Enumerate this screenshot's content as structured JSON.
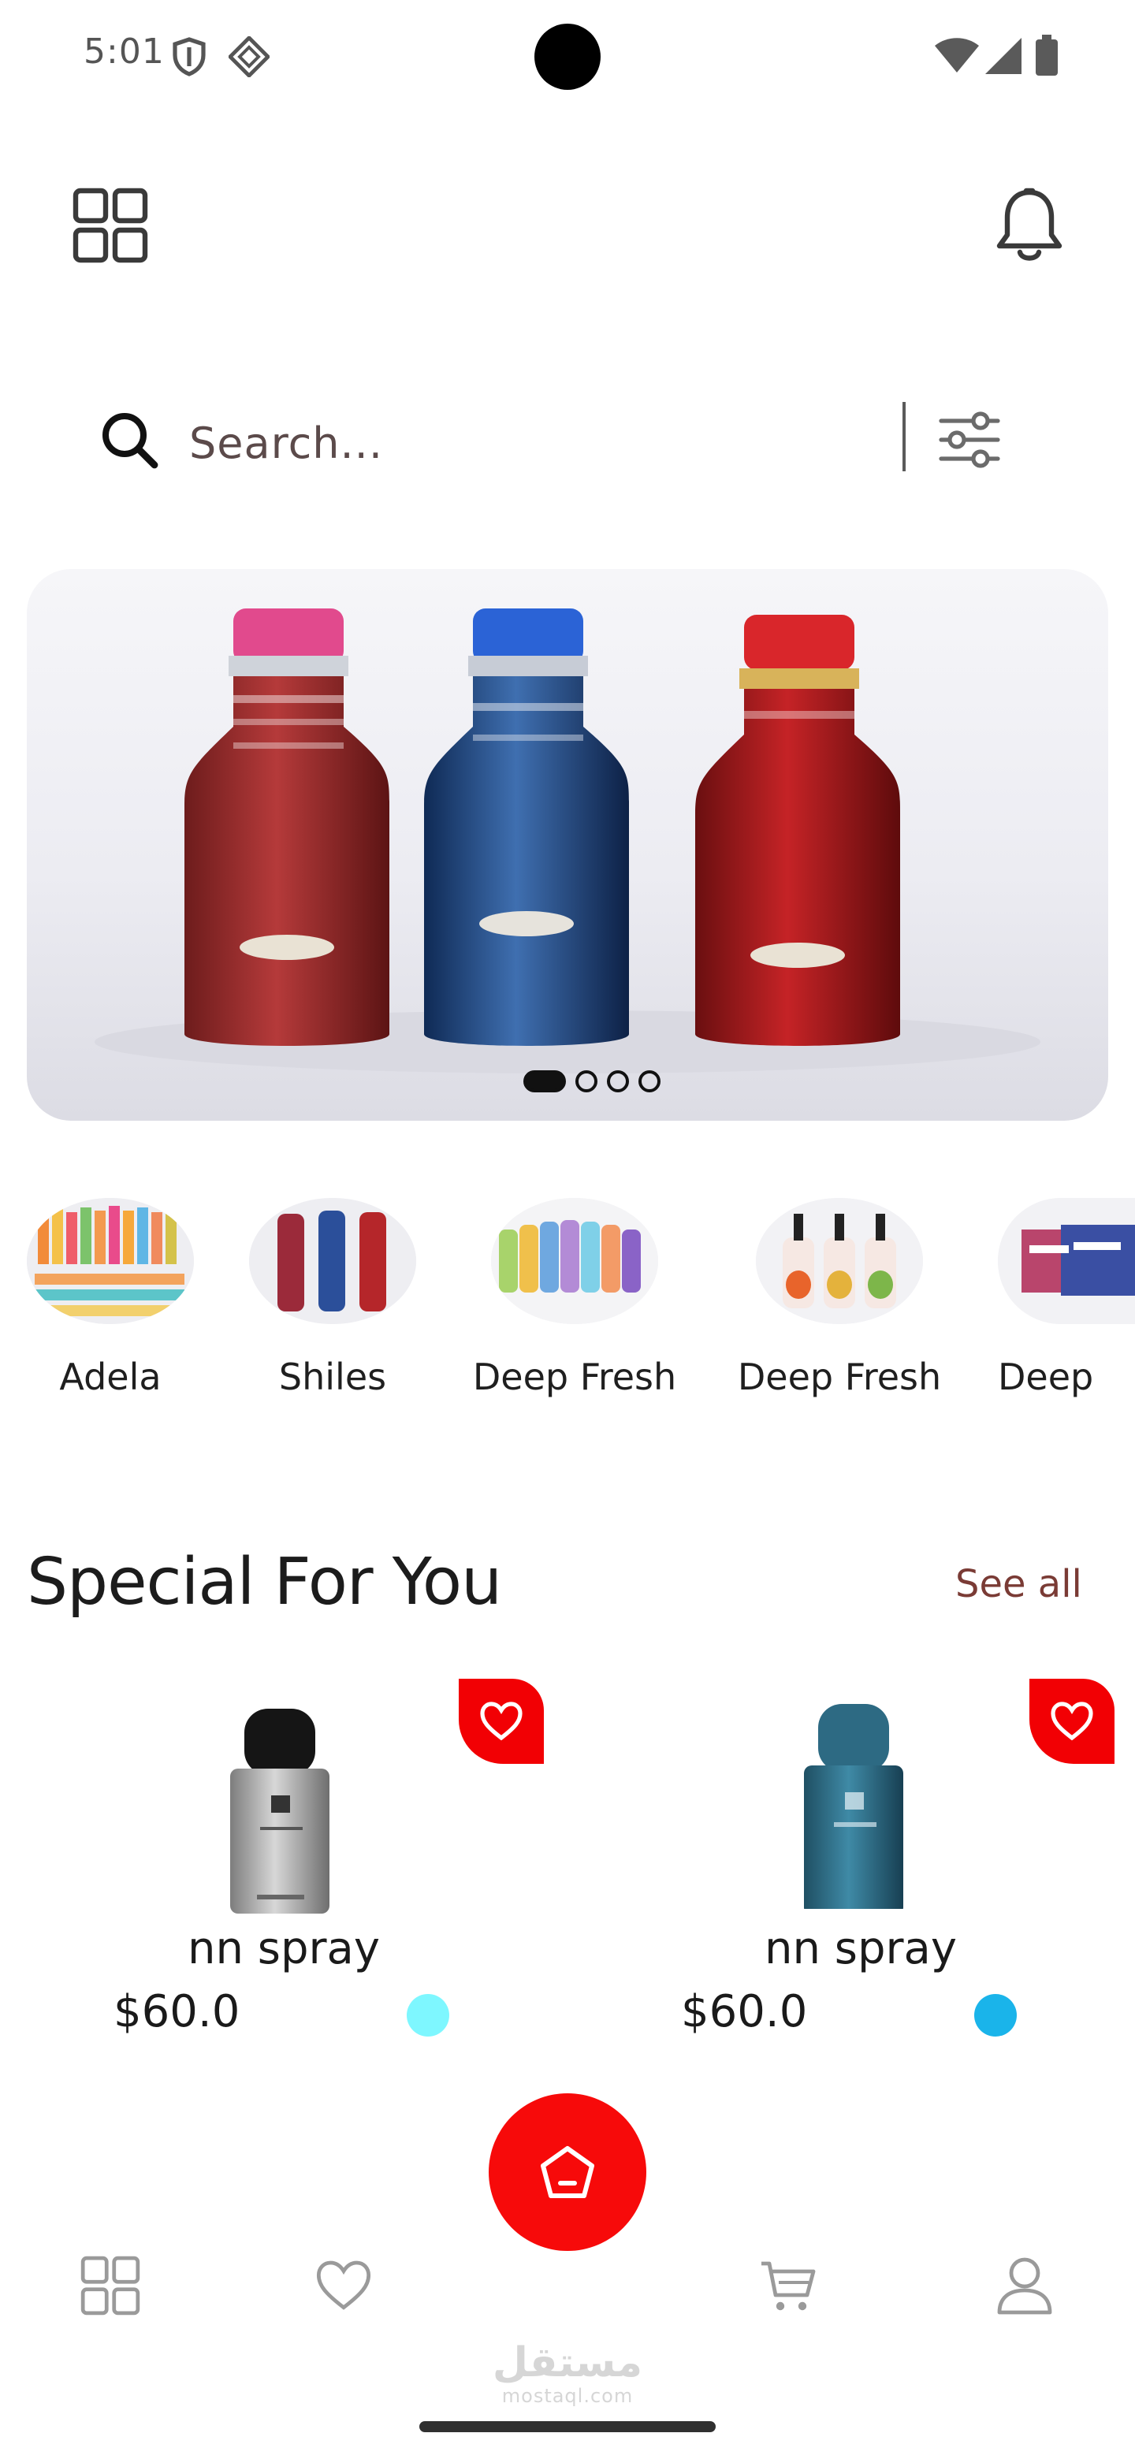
{
  "status_bar": {
    "time": "5:01",
    "icons": [
      "shield-icon",
      "diamond-icon",
      "wifi-icon",
      "signal-icon",
      "battery-icon"
    ]
  },
  "header": {
    "menu_icon": "grid-icon",
    "notification_icon": "bell-icon"
  },
  "search": {
    "placeholder": "Search...",
    "filter_icon": "sliders-icon"
  },
  "banner": {
    "slide_count": 4,
    "active_slide": 1
  },
  "categories": [
    {
      "label": "Adela"
    },
    {
      "label": "Shiles"
    },
    {
      "label": "Deep Fresh"
    },
    {
      "label": "Deep Fresh"
    },
    {
      "label": "Deep"
    }
  ],
  "special_section": {
    "title": "Special For You",
    "see_all": "See all"
  },
  "products": [
    {
      "name": "nn spray",
      "price": "$60.0",
      "color": "#7ef7ff"
    },
    {
      "name": "nn spray",
      "price": "$60.0",
      "color": "#1ab4ea"
    }
  ],
  "bottom_nav": {
    "items": [
      "grid-icon",
      "heart-icon",
      "home-icon",
      "cart-icon",
      "user-icon"
    ],
    "active": "home-icon"
  },
  "watermark": {
    "arabic": "مستقل",
    "latin": "mostaql.com"
  },
  "colors": {
    "accent": "#f70a0a",
    "see_all": "#7a3b35",
    "text": "#1c1c1c"
  }
}
